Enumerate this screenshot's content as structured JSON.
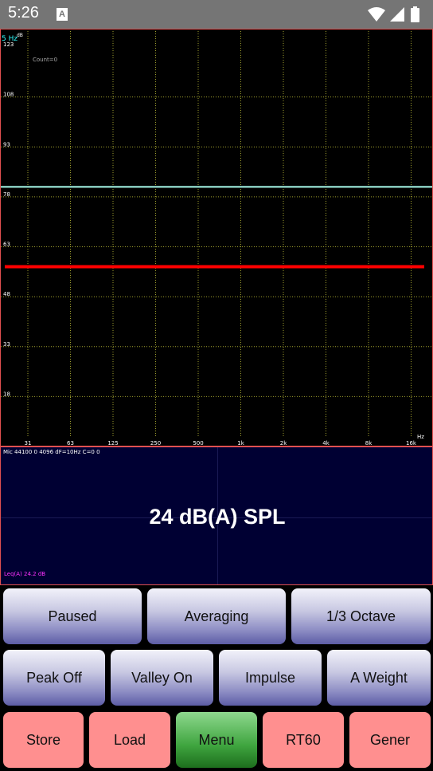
{
  "status_bar": {
    "time": "5:26",
    "notification_icon": "A",
    "icons": [
      "wifi-icon",
      "signal-icon",
      "battery-icon"
    ]
  },
  "plot": {
    "freq_label": "5 Hz",
    "db_unit": "dB",
    "hz_unit": "Hz",
    "count_label": "Count=0",
    "y_ticks": [
      "123",
      "108",
      "93",
      "78",
      "63",
      "48",
      "33",
      "18"
    ],
    "x_ticks": [
      "31",
      "63",
      "125",
      "250",
      "500",
      "1k",
      "2k",
      "4k",
      "8k",
      "16k"
    ],
    "colors": {
      "grid": "#c8c83a",
      "trace_red": "#ff0000",
      "trace_cyan": "#aaffee",
      "border": "#e05050"
    },
    "chart_data": {
      "type": "line",
      "xlabel": "Hz",
      "ylabel": "dB",
      "ylim": [
        3,
        123
      ],
      "series": [
        {
          "color": "#aaffee",
          "values": [
            81,
            81
          ]
        },
        {
          "color": "#ff0000",
          "values": [
            57,
            57
          ]
        }
      ]
    }
  },
  "spl_panel": {
    "info": "Mic 44100 0 4096 dF=10Hz C=0 0",
    "reading": "24 dB(A) SPL",
    "leq": "Leq(A) 24.2 dB"
  },
  "buttons": {
    "row1": [
      "Paused",
      "Averaging",
      "1/3 Octave"
    ],
    "row2": [
      "Peak Off",
      "Valley On",
      "Impulse",
      "A Weight"
    ],
    "row3": [
      "Store",
      "Load",
      "Menu",
      "RT60",
      "Gener"
    ]
  }
}
